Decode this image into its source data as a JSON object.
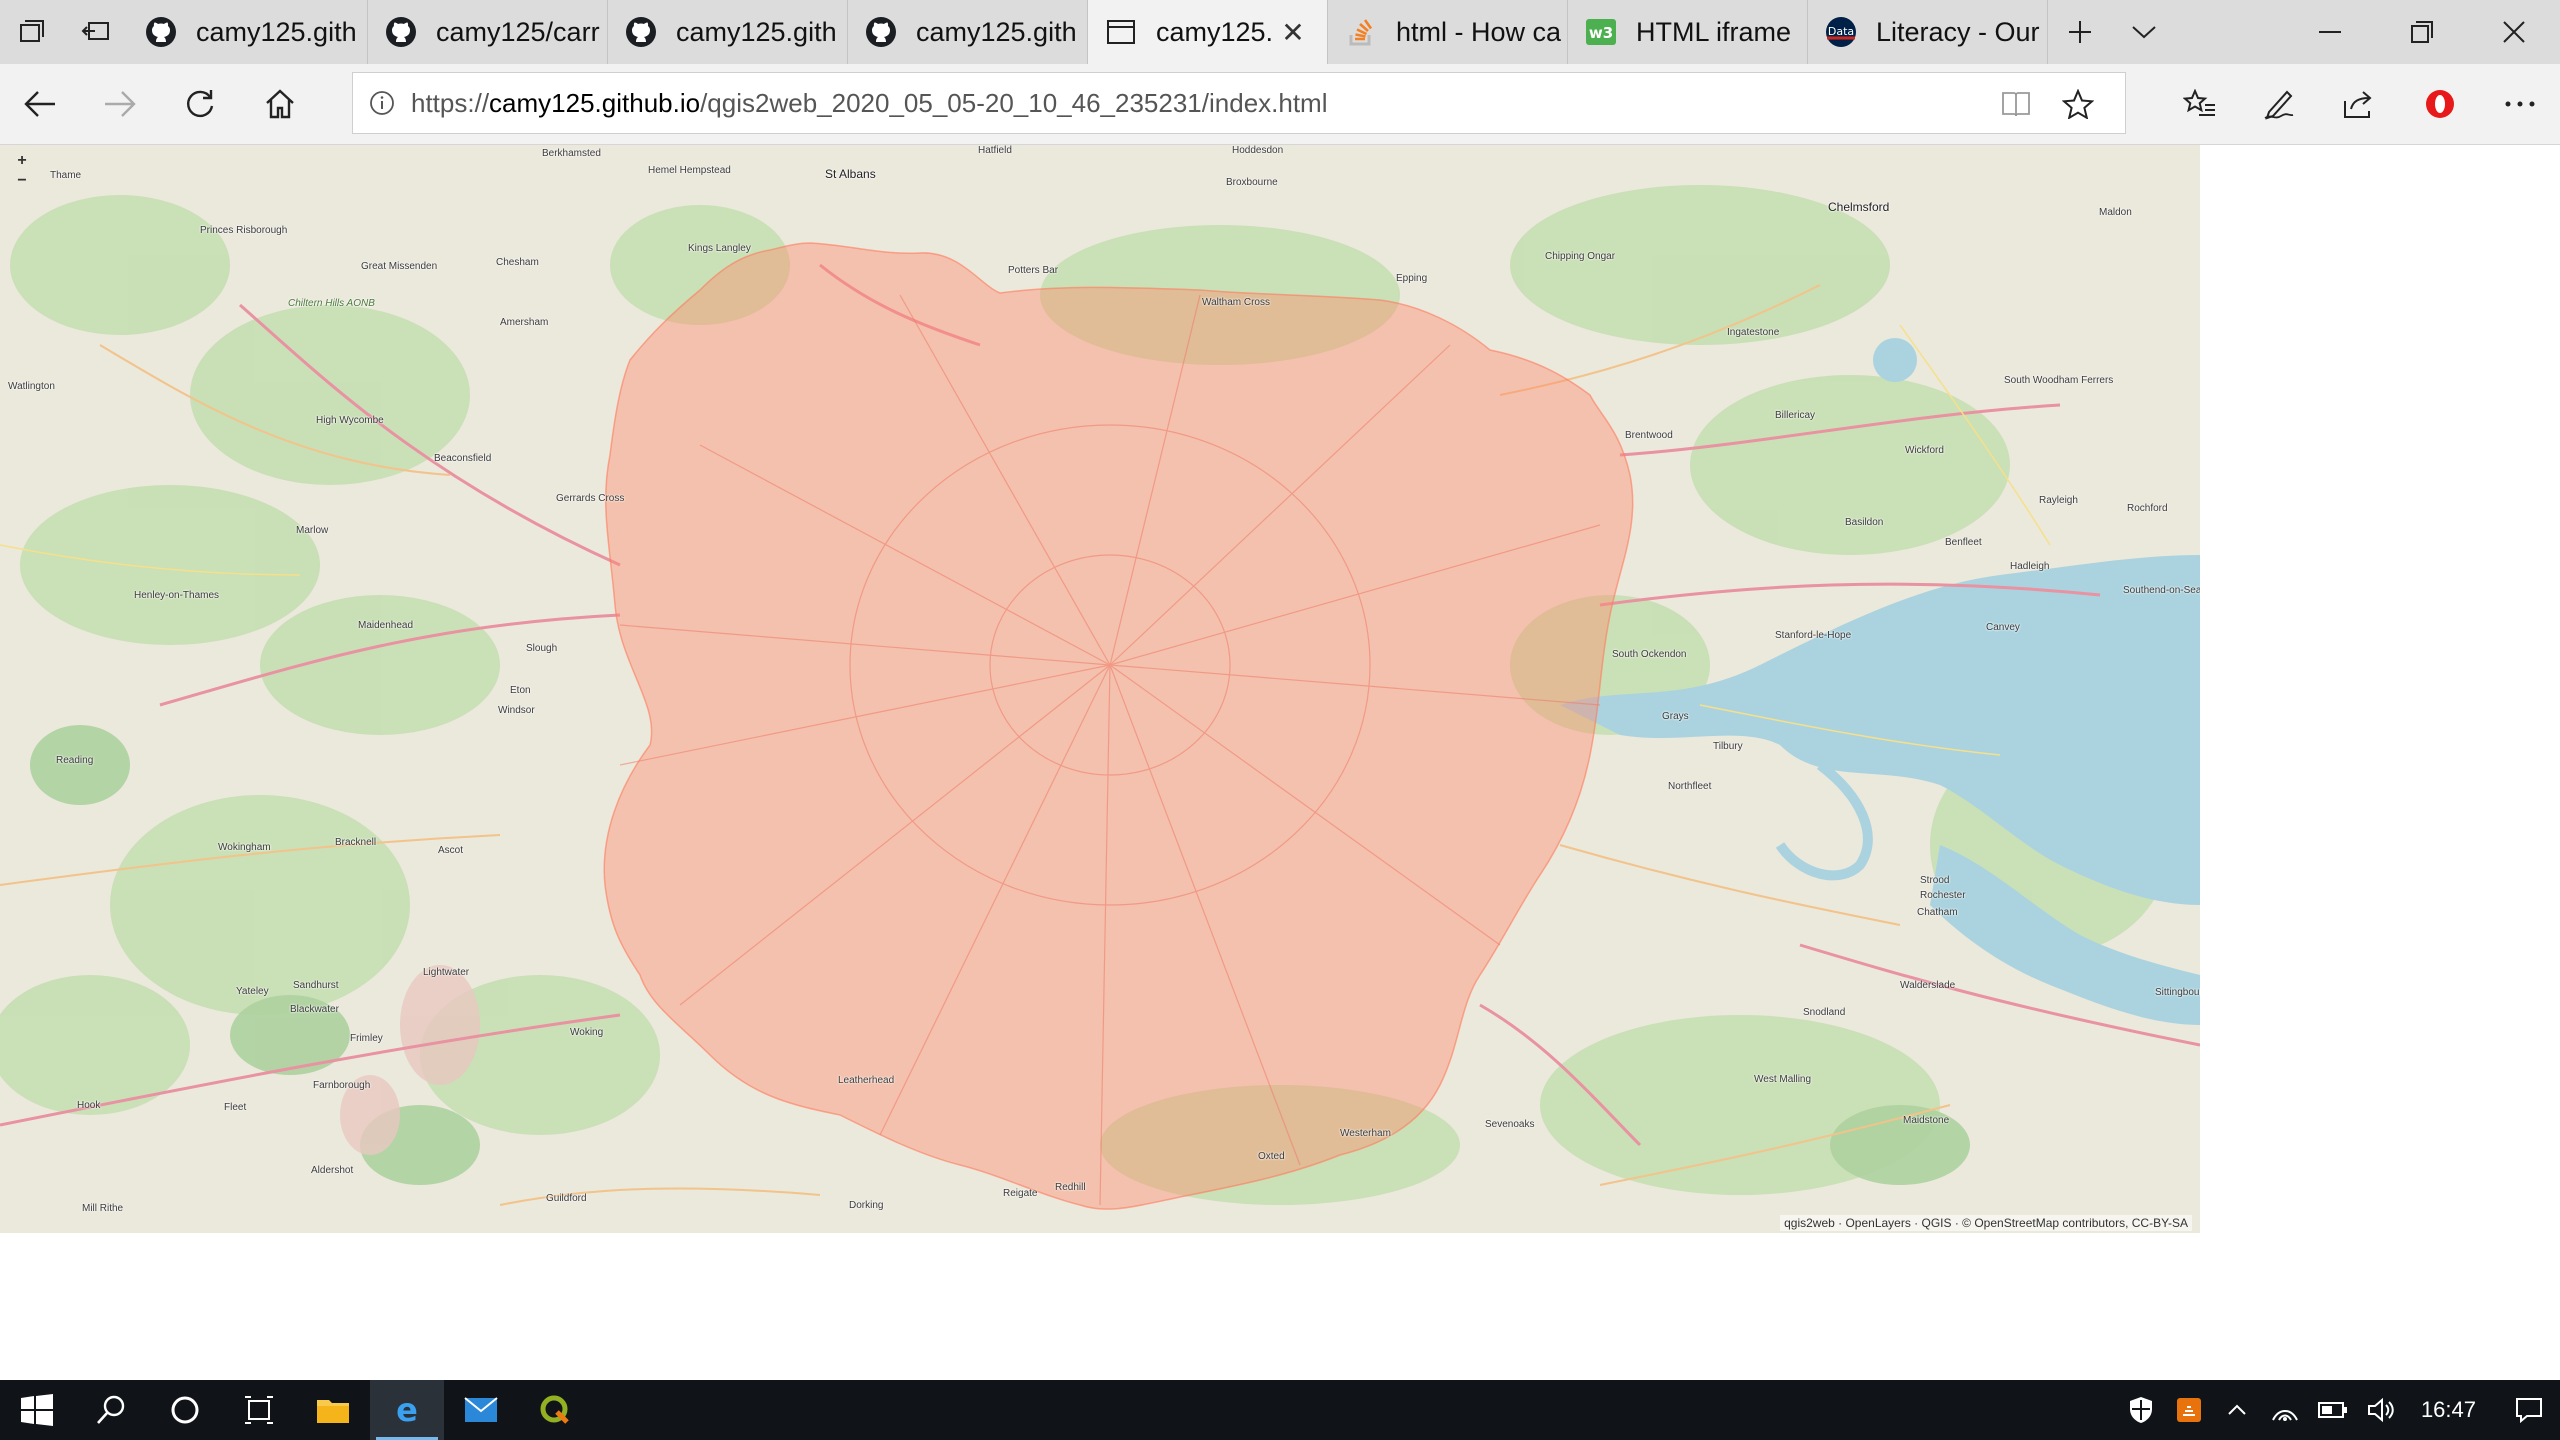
{
  "browser": {
    "tabs": [
      {
        "label": "camy125.gith",
        "icon": "github-icon",
        "active": false
      },
      {
        "label": "camy125/carr",
        "icon": "github-icon",
        "active": false
      },
      {
        "label": "camy125.gith",
        "icon": "github-icon",
        "active": false
      },
      {
        "label": "camy125.gith",
        "icon": "github-icon",
        "active": false
      },
      {
        "label": "camy125.",
        "icon": "page-icon",
        "active": true
      },
      {
        "label": "html - How ca",
        "icon": "stackoverflow-icon",
        "active": false
      },
      {
        "label": "HTML iframe",
        "icon": "w3schools-icon",
        "active": false
      },
      {
        "label": "Literacy - Our",
        "icon": "owid-icon",
        "active": false
      }
    ],
    "address": {
      "url_prefix": "https://",
      "url_host": "camy125.github.io",
      "url_path": "/qgis2web_2020_05_05-20_10_46_235231/index.html"
    }
  },
  "map": {
    "zoom_in": "+",
    "zoom_out": "−",
    "attribution": "qgis2web · OpenLayers · QGIS · © OpenStreetMap contributors, CC-BY-SA",
    "overlay_color": "#ff8a6b",
    "water_color": "#aad3df",
    "places": [
      "Thame",
      "Berkhamsted",
      "Hemel Hempstead",
      "St Albans",
      "Hatfield",
      "Hoddesdon",
      "Broxbourne",
      "Chelmsford",
      "Maldon",
      "Princes Risborough",
      "Kings Langley",
      "Potters Bar",
      "Waltham Cross",
      "Epping",
      "Chipping Ongar",
      "Great Missenden",
      "Chesham",
      "Chiltern Hills AONB",
      "Amersham",
      "Ingatestone",
      "South Woodham Ferrers",
      "Watlington",
      "High Wycombe",
      "Beaconsfield",
      "Brentwood",
      "Billericay",
      "Wickford",
      "Rochford",
      "Rayleigh",
      "Basildon",
      "Benfleet",
      "Hadleigh",
      "Southend-on-Sea",
      "Marlow",
      "Henley-on-Thames",
      "Gerrards Cross",
      "Maidenhead",
      "Stanford-le-Hope",
      "Canvey",
      "Slough",
      "Eton",
      "Windsor",
      "South Ockendon",
      "Grays",
      "Tilbury",
      "Reading",
      "Northfleet",
      "Wokingham",
      "Bracknell",
      "Ascot",
      "Strood",
      "Rochester",
      "Chatham",
      "Sandhurst",
      "Yateley",
      "Blackwater",
      "Lightwater",
      "Frimley",
      "Woking",
      "Farnborough",
      "Fleet",
      "Hook",
      "Aldershot",
      "Guildford",
      "Dorking",
      "Reigate",
      "Redhill",
      "Oxted",
      "Leatherhead",
      "Westerham",
      "Sevenoaks",
      "West Malling",
      "Maidstone",
      "Snodland",
      "Walderslade",
      "Sittingbourne",
      "Mill Rithe"
    ]
  },
  "taskbar": {
    "clock": "16:47",
    "apps": [
      "file-explorer-icon",
      "edge-icon",
      "mail-icon",
      "qgis-icon"
    ]
  }
}
